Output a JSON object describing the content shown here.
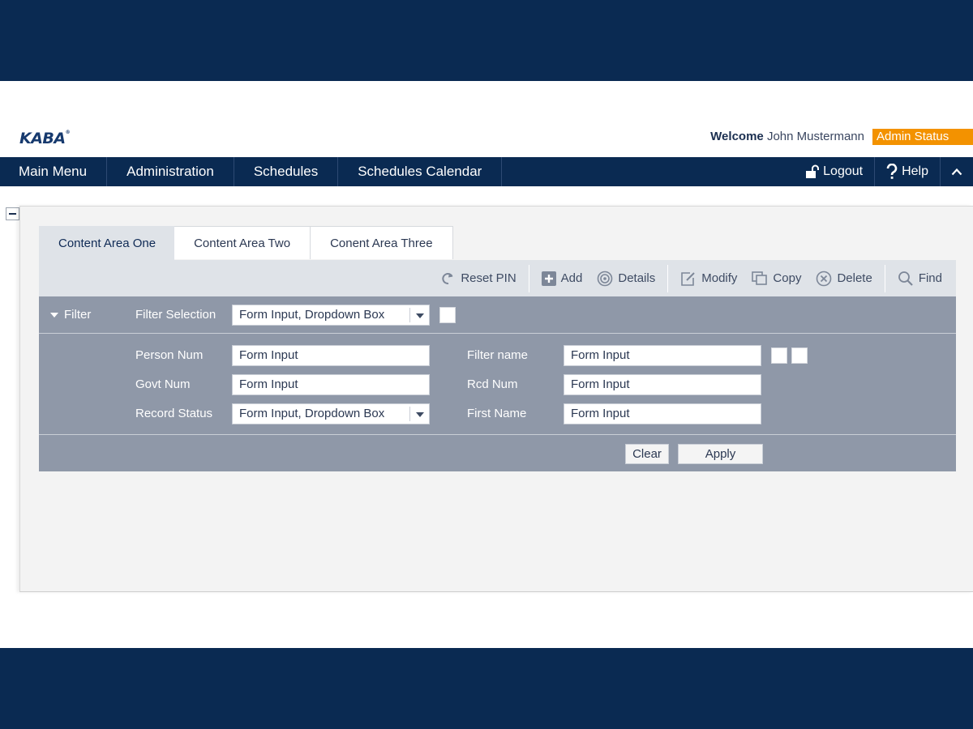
{
  "brand": {
    "logo_text": "KABA",
    "logo_mark": "®"
  },
  "user": {
    "welcome_label": "Welcome",
    "name": "John Mustermann",
    "status_badge": "Admin Status"
  },
  "nav": {
    "items": [
      {
        "label": "Main Menu"
      },
      {
        "label": "Administration"
      },
      {
        "label": "Schedules"
      },
      {
        "label": "Schedules Calendar"
      }
    ],
    "logout_label": "Logout",
    "help_label": "Help"
  },
  "tabs": [
    {
      "label": "Content Area One",
      "active": true
    },
    {
      "label": "Content Area Two",
      "active": false
    },
    {
      "label": "Conent Area Three",
      "active": false
    }
  ],
  "toolbar": {
    "reset_pin": "Reset PIN",
    "add": "Add",
    "details": "Details",
    "modify": "Modify",
    "copy": "Copy",
    "delete": "Delete",
    "find": "Find"
  },
  "filter": {
    "toggle_label": "Filter",
    "selection_label": "Filter Selection",
    "selection_value": "Form Input, Dropdown Box",
    "fields": {
      "person_num": {
        "label": "Person Num",
        "value": "Form Input"
      },
      "govt_num": {
        "label": "Govt Num",
        "value": "Form Input"
      },
      "record_status": {
        "label": "Record Status",
        "value": "Form Input, Dropdown Box"
      },
      "filter_name": {
        "label": "Filter name",
        "value": "Form Input"
      },
      "rcd_num": {
        "label": "Rcd Num",
        "value": "Form Input"
      },
      "first_name": {
        "label": "First Name",
        "value": "Form Input"
      }
    },
    "clear_label": "Clear",
    "apply_label": "Apply"
  },
  "colors": {
    "navy": "#0a2a52",
    "accent_orange": "#f39200",
    "filter_bg": "#8f98a8",
    "toolbar_bg": "#dfe3e8"
  }
}
